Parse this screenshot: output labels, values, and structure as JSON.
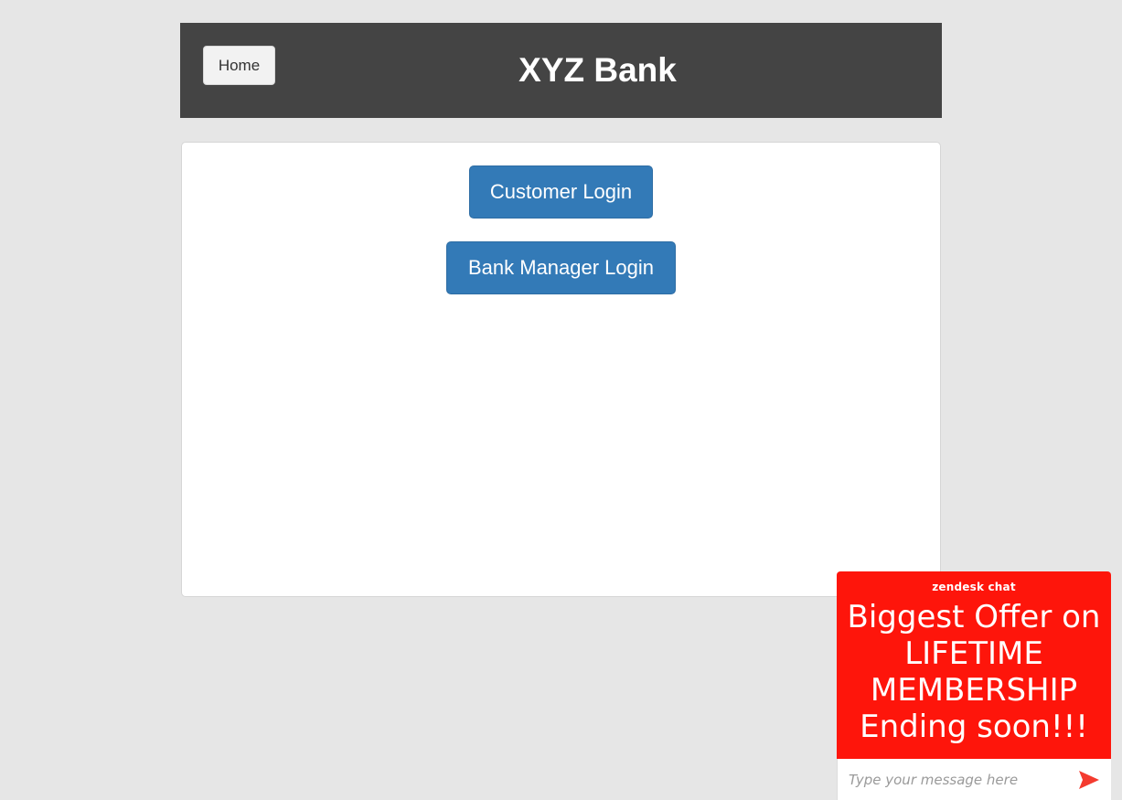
{
  "header": {
    "home_label": "Home",
    "title": "XYZ Bank"
  },
  "login": {
    "customer_label": "Customer Login",
    "manager_label": "Bank Manager Login"
  },
  "chat": {
    "brand": "zendesk chat",
    "offer_text": "Biggest Offer on\nLIFETIME\nMEMBERSHIP\nEnding soon!!!",
    "input_placeholder": "Type your message here",
    "send_icon": "send-arrow-icon"
  },
  "colors": {
    "page_bg": "#e6e6e6",
    "header_bg": "#444444",
    "primary": "#337ab7",
    "chat_bg": "#fe150b",
    "send_icon": "#f43b2f"
  }
}
